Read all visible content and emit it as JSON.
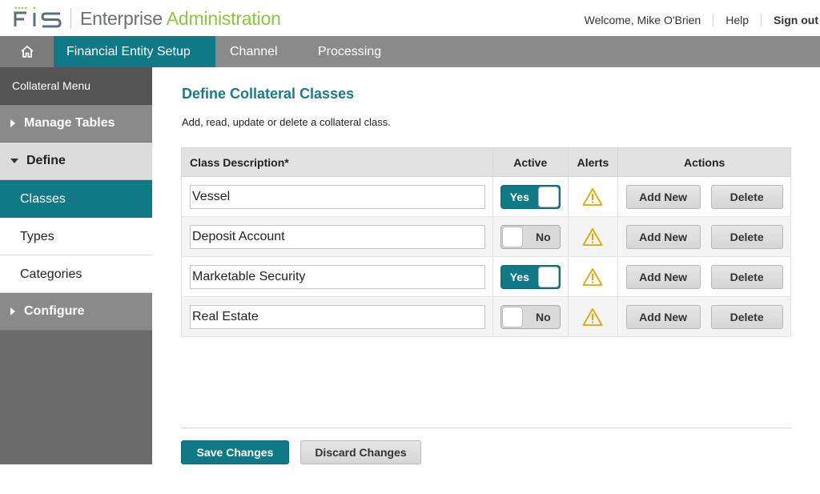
{
  "header": {
    "logo_text": "FIS",
    "title_plain": "Enterprise ",
    "title_accent": "Administration",
    "welcome": "Welcome, Mike O'Brien",
    "help": "Help",
    "signout": "Sign out"
  },
  "nav": {
    "home_icon": "home-icon",
    "tabs": [
      {
        "label": "Financial Entity Setup",
        "active": true
      },
      {
        "label": "Channel",
        "active": false
      },
      {
        "label": "Processing",
        "active": false
      }
    ]
  },
  "sidebar": {
    "heading": "Collateral Menu",
    "groups": [
      {
        "label": "Manage Tables",
        "open": false
      },
      {
        "label": "Define",
        "open": true,
        "items": [
          {
            "label": "Classes",
            "active": true
          },
          {
            "label": "Types",
            "active": false
          },
          {
            "label": "Categories",
            "active": false
          }
        ]
      },
      {
        "label": "Configure",
        "open": false
      }
    ]
  },
  "main": {
    "title": "Define Collateral Classes",
    "description": "Add, read, update or delete a collateral class.",
    "columns": [
      "Class Description*",
      "Active",
      "Alerts",
      "Actions"
    ],
    "rows": [
      {
        "description": "Vessel",
        "active": true,
        "toggle_label": "Yes",
        "alert_icon": "warning-icon"
      },
      {
        "description": "Deposit Account",
        "active": false,
        "toggle_label": "No",
        "alert_icon": "warning-icon"
      },
      {
        "description": "Marketable Security",
        "active": true,
        "toggle_label": "Yes",
        "alert_icon": "warning-icon"
      },
      {
        "description": "Real Estate",
        "active": false,
        "toggle_label": "No",
        "alert_icon": "warning-icon"
      }
    ],
    "add_new_label": "Add New",
    "delete_label": "Delete",
    "save_label": "Save Changes",
    "discard_label": "Discard Changes"
  },
  "colors": {
    "accent": "#0f7a86",
    "brand_green": "#8cc63e",
    "warning": "#e0a800"
  }
}
